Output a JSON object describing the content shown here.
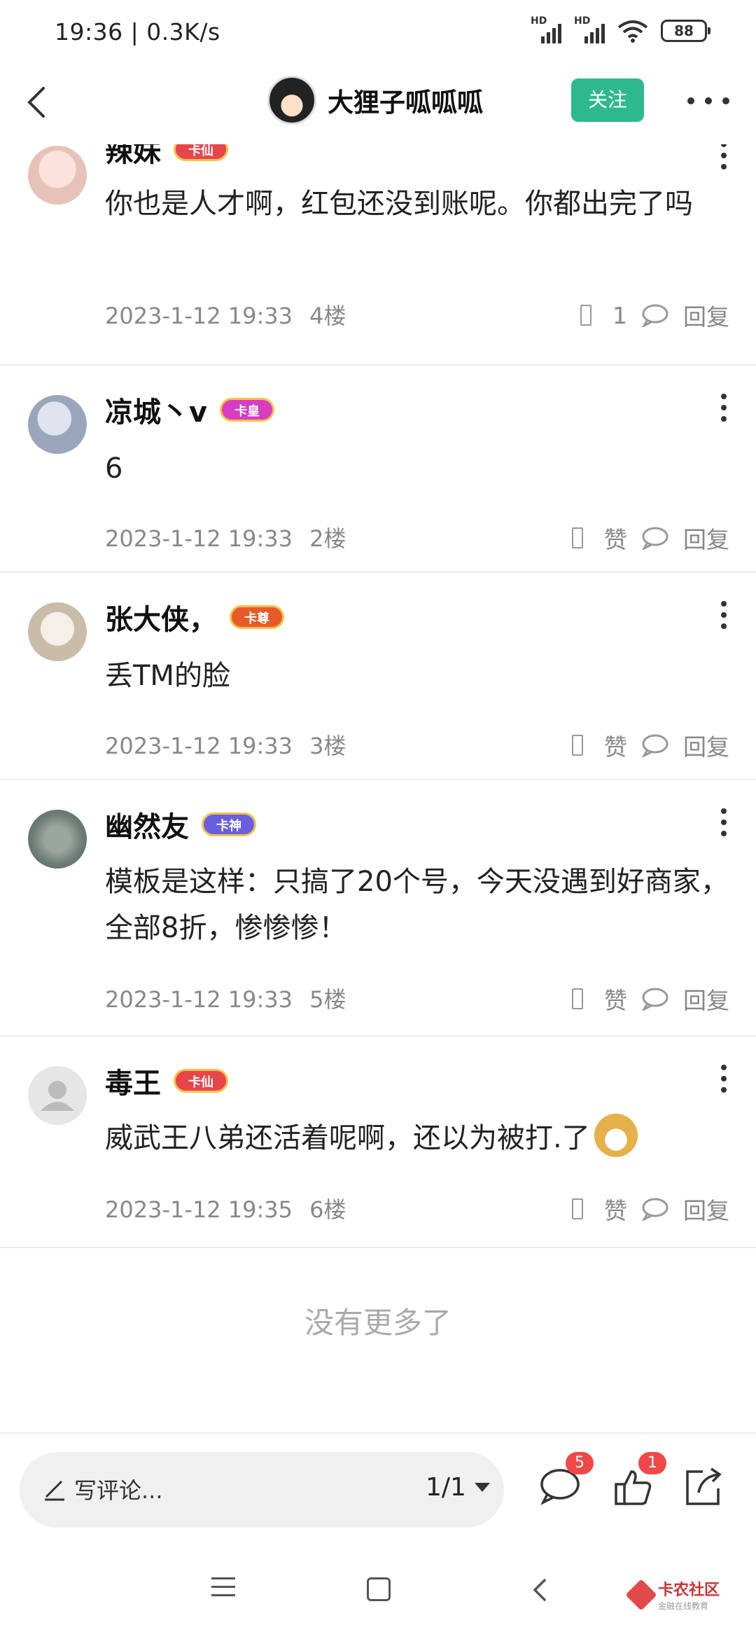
{
  "status_bar": {
    "time": "19:36 | 0.3K/s",
    "signal_1": "HD",
    "signal_2": "HD",
    "battery": "88"
  },
  "nav": {
    "title": "大狸子呱呱呱",
    "follow_label": "关注",
    "icons": [
      "back-arrow-icon",
      "more-icon"
    ]
  },
  "comments": [
    {
      "name": "辣妹",
      "badge": "卡仙",
      "badge_color": "#e8454a",
      "avatar_color": "#f1d3cf",
      "body": "你也是人才啊，红包还没到账呢。你都出完了吗",
      "date": "2023-1-12 19:33",
      "floor": "4楼",
      "like": "1",
      "reply": "回复"
    },
    {
      "name": "凉城丶v",
      "badge": "卡皇",
      "badge_color": "#d83cc0",
      "avatar_color": "#b9c3d3",
      "body": "6",
      "date": "2023-1-12 19:33",
      "floor": "2楼",
      "like": "赞",
      "reply": "回复"
    },
    {
      "name": "张大侠，",
      "badge": "卡尊",
      "badge_color": "#e85a2a",
      "avatar_color": "#d7cfc3",
      "body": "丢TM的脸",
      "date": "2023-1-12 19:33",
      "floor": "3楼",
      "like": "赞",
      "reply": "回复"
    },
    {
      "name": "幽然友",
      "badge": "卡神",
      "badge_color": "#6a5ee0",
      "avatar_color": "#7d8c86",
      "body": "模板是这样：只搞了20个号，今天没遇到好商家，全部8折，惨惨惨！",
      "date": "2023-1-12 19:33",
      "floor": "5楼",
      "like": "赞",
      "reply": "回复"
    },
    {
      "name": "毒王",
      "badge": "卡仙",
      "badge_color": "#e8454a",
      "avatar_color": "#e6e6e6",
      "body": "威武王八弟还活着呢啊，还以为被打.了",
      "date": "2023-1-12 19:35",
      "floor": "6楼",
      "like": "赞",
      "reply": "回复"
    }
  ],
  "no_more": "没有更多了",
  "bottom_bar": {
    "placeholder": "写评论...",
    "pager": "1/1",
    "comment_count": "5",
    "like_count": "1"
  },
  "watermark": {
    "title": "卡农社区",
    "subtitle": "金融在线教育"
  }
}
